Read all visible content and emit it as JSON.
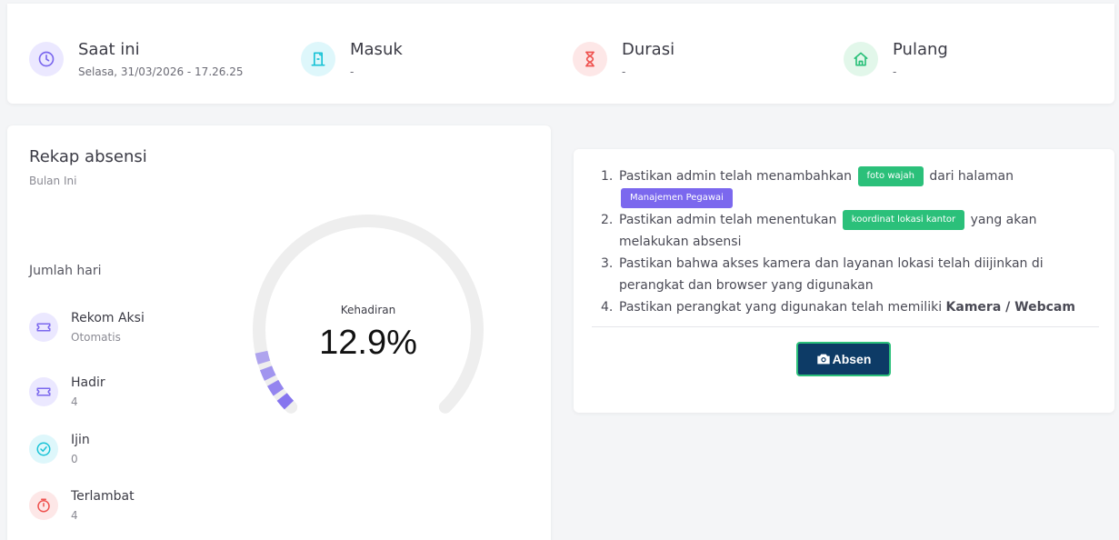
{
  "stats": [
    {
      "title": "Saat ini",
      "sub": "Selasa, 31/03/2026 - 17.26.25",
      "icon": "clock-icon",
      "color": "#7b68ee"
    },
    {
      "title": "Masuk",
      "sub": "-",
      "icon": "door-enter-icon",
      "color": "#19c3d6"
    },
    {
      "title": "Durasi",
      "sub": "-",
      "icon": "hourglass-icon",
      "color": "#ef5350"
    },
    {
      "title": "Pulang",
      "sub": "-",
      "icon": "home-icon",
      "color": "#2bc07a"
    }
  ],
  "rekap": {
    "title": "Rekap absensi",
    "subtitle": "Bulan Ini",
    "jumlah_label": "Jumlah hari",
    "items": [
      {
        "name": "Rekom Aksi",
        "value": "Otomatis",
        "icon": "ticket-icon",
        "color": "#7b68ee"
      },
      {
        "name": "Hadir",
        "value": "4",
        "icon": "ticket-icon",
        "color": "#7b68ee"
      },
      {
        "name": "Ijin",
        "value": "0",
        "icon": "check-circle-icon",
        "color": "#19c3d6"
      },
      {
        "name": "Terlambat",
        "value": "4",
        "icon": "alarm-icon",
        "color": "#ef5350"
      }
    ],
    "gauge": {
      "label": "Kehadiran",
      "value_text": "12.9%",
      "percent": 12.9,
      "track_color": "#eeeeee",
      "fill_color": "#7b68ee"
    }
  },
  "instructions": {
    "items": [
      {
        "num": "1.",
        "before": "Pastikan admin telah menambahkan",
        "badge": "foto wajah",
        "after": "dari halaman",
        "badge2": "Manajemen Pegawai"
      },
      {
        "num": "2.",
        "before": "Pastikan admin telah menentukan",
        "badge": "koordinat lokasi kantor",
        "after": "yang akan melakukan absensi"
      },
      {
        "num": "3.",
        "text": "Pastikan bahwa akses kamera dan layanan lokasi telah diijinkan di perangkat dan browser yang digunakan"
      },
      {
        "num": "4.",
        "before": "Pastikan perangkat yang digunakan telah memiliki",
        "bold": "Kamera / Webcam"
      }
    ],
    "button_label": "Absen"
  }
}
